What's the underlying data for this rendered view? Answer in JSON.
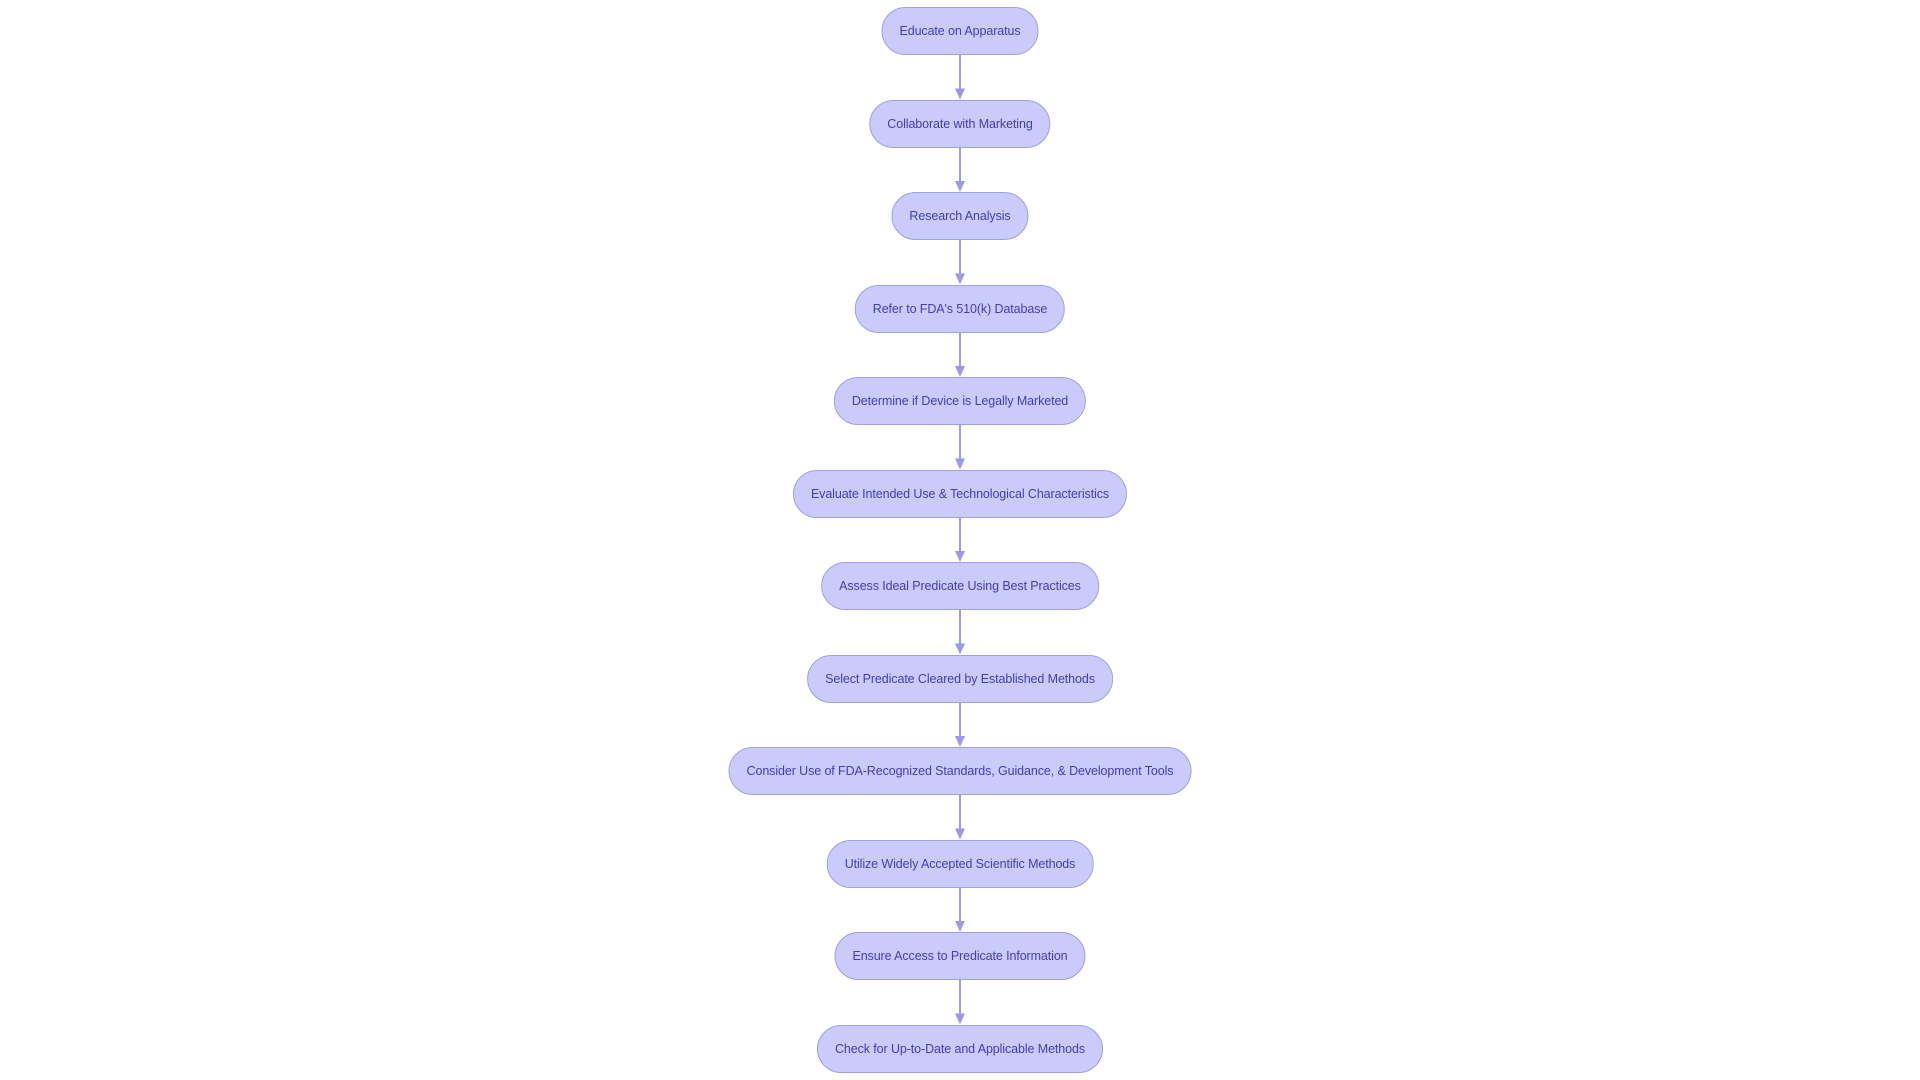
{
  "diagram": {
    "type": "flowchart",
    "direction": "top-down",
    "colors": {
      "node_fill": "#cbcbfb",
      "node_border": "#9f9fe6",
      "node_text": "#3e3eb8",
      "edge": "#9a9ae6"
    },
    "nodes": [
      {
        "id": "n1",
        "label": "Educate on Apparatus"
      },
      {
        "id": "n2",
        "label": "Collaborate with Marketing"
      },
      {
        "id": "n3",
        "label": "Research Analysis"
      },
      {
        "id": "n4",
        "label": "Refer to FDA's 510(k) Database"
      },
      {
        "id": "n5",
        "label": "Determine if Device is Legally Marketed"
      },
      {
        "id": "n6",
        "label": "Evaluate Intended Use & Technological Characteristics"
      },
      {
        "id": "n7",
        "label": "Assess Ideal Predicate Using Best Practices"
      },
      {
        "id": "n8",
        "label": "Select Predicate Cleared by Established Methods"
      },
      {
        "id": "n9",
        "label": "Consider Use of FDA-Recognized Standards, Guidance, & Development Tools"
      },
      {
        "id": "n10",
        "label": "Utilize Widely Accepted Scientific Methods"
      },
      {
        "id": "n11",
        "label": "Ensure Access to Predicate Information"
      },
      {
        "id": "n12",
        "label": "Check for Up-to-Date and Applicable Methods"
      }
    ],
    "edges": [
      {
        "from": "n1",
        "to": "n2"
      },
      {
        "from": "n2",
        "to": "n3"
      },
      {
        "from": "n3",
        "to": "n4"
      },
      {
        "from": "n4",
        "to": "n5"
      },
      {
        "from": "n5",
        "to": "n6"
      },
      {
        "from": "n6",
        "to": "n7"
      },
      {
        "from": "n7",
        "to": "n8"
      },
      {
        "from": "n8",
        "to": "n9"
      },
      {
        "from": "n9",
        "to": "n10"
      },
      {
        "from": "n10",
        "to": "n11"
      },
      {
        "from": "n11",
        "to": "n12"
      }
    ]
  }
}
